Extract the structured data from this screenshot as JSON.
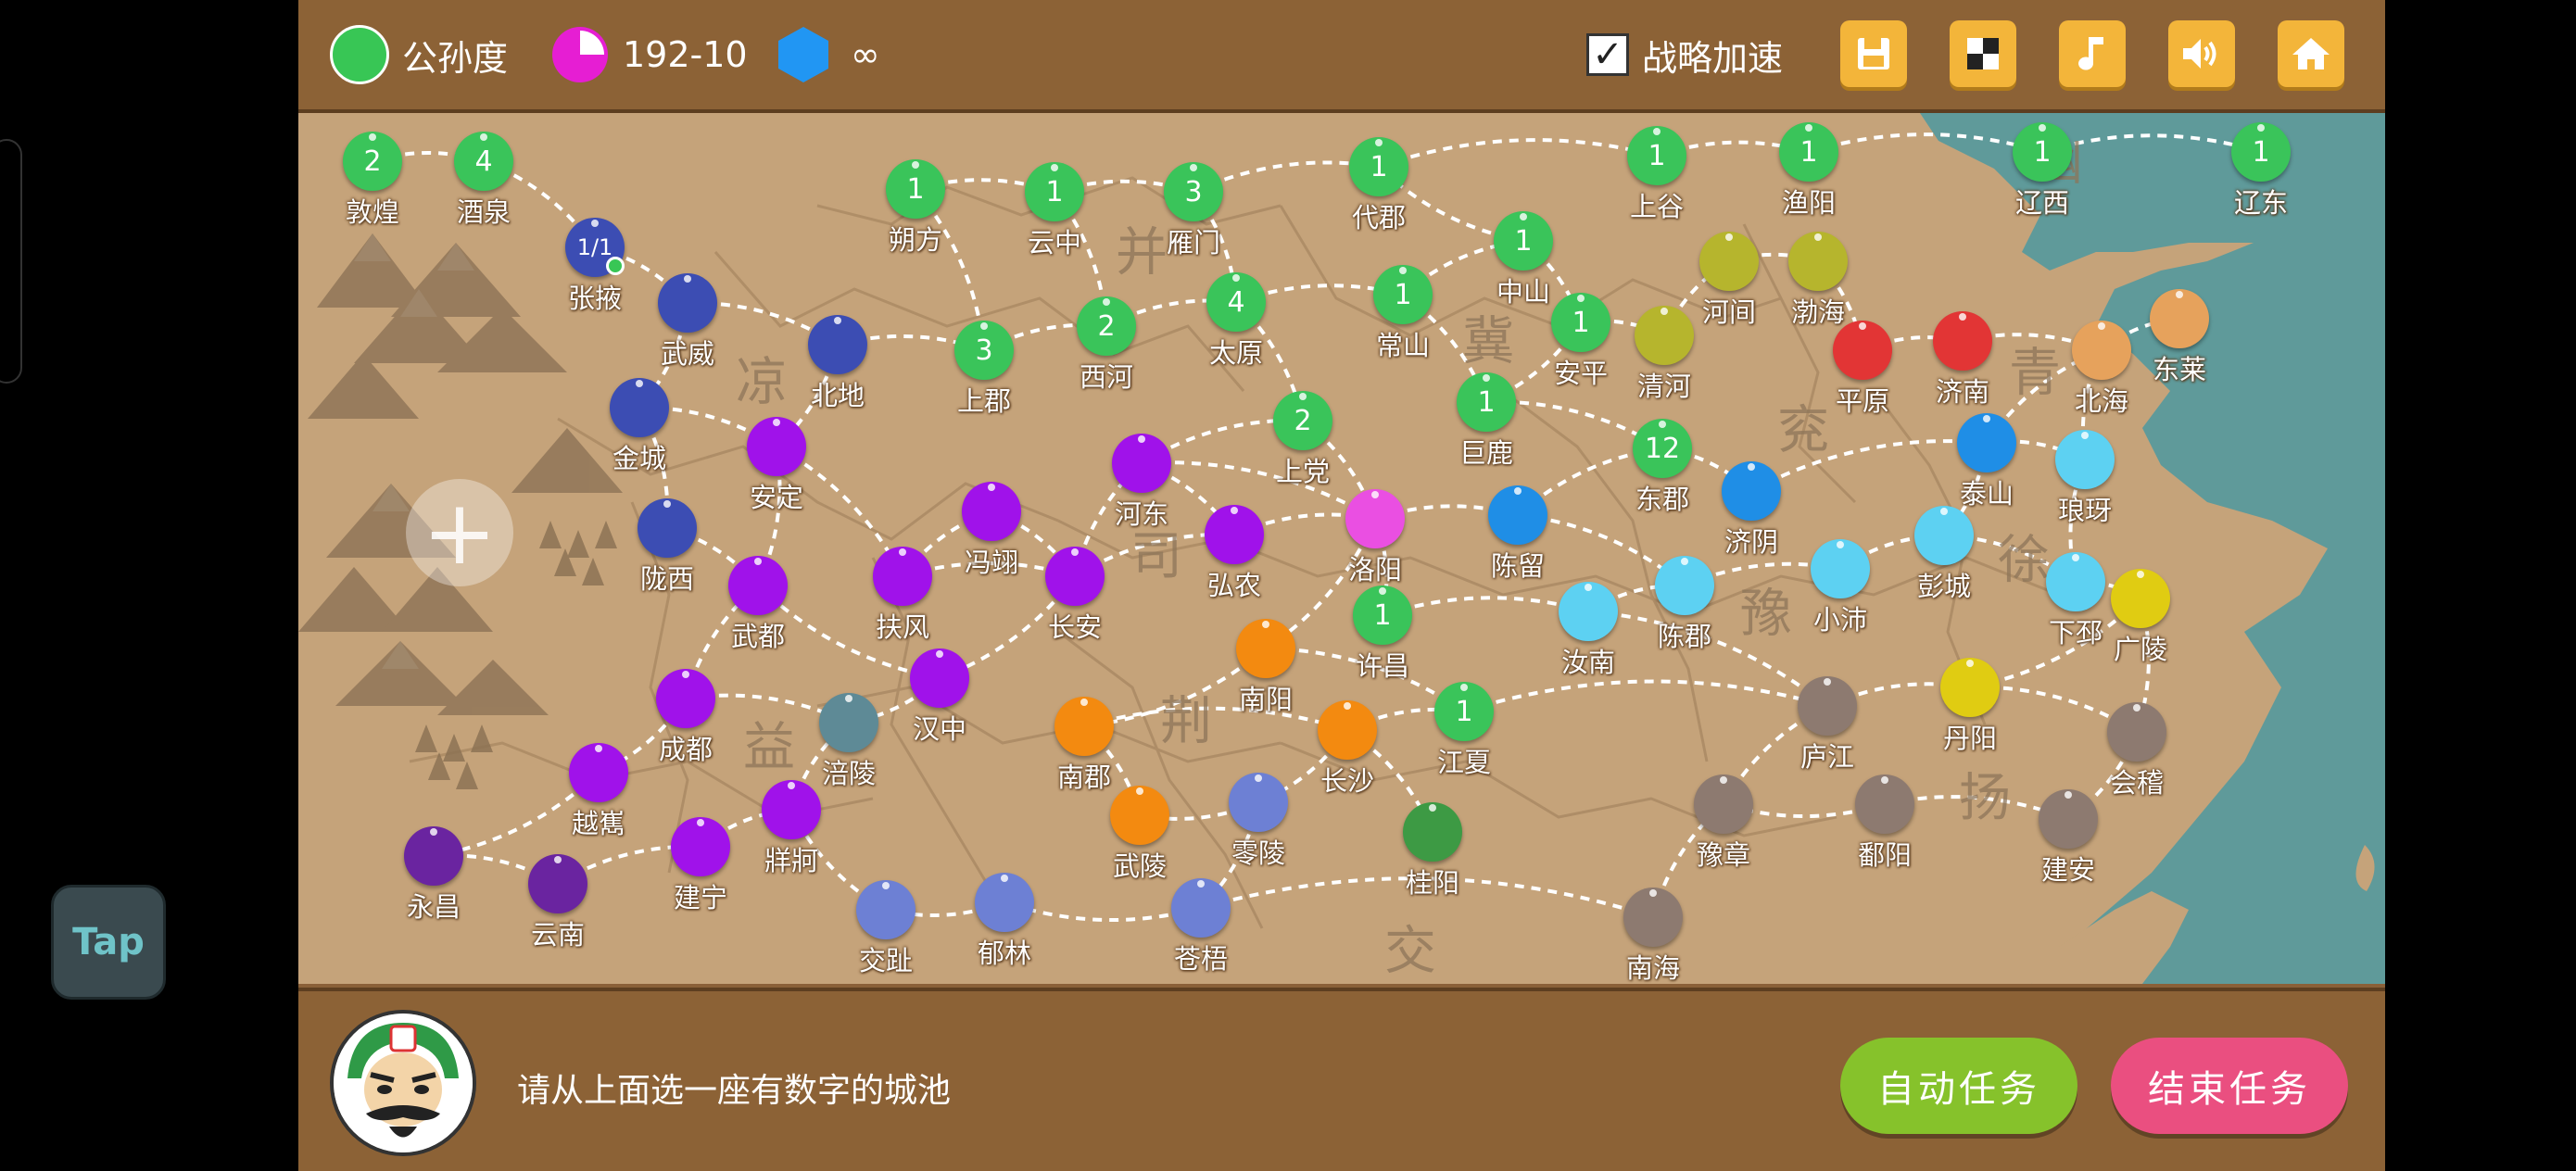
{
  "tap_label": "Tap",
  "topbar": {
    "ruler_name": "公孙度",
    "ruler_color": "#38c655",
    "date": "192-10",
    "date_icon_color": "#e61ed3",
    "resource": "∞",
    "resource_icon_color": "#2196f3",
    "speedup_label": "战略加速",
    "speedup_checked": "✓",
    "buttons": [
      "save-icon",
      "layout-icon",
      "music-icon",
      "sound-icon",
      "home-icon"
    ]
  },
  "map": {
    "zoom_label": "+",
    "regions": [
      "幽",
      "并",
      "冀",
      "凉",
      "司",
      "兖",
      "青",
      "徐",
      "豫",
      "荆",
      "益",
      "扬",
      "交"
    ],
    "cities": [
      {
        "name": "敦煌",
        "color": "#3ac45a",
        "num": "2"
      },
      {
        "name": "酒泉",
        "color": "#3ac45a",
        "num": "4"
      },
      {
        "name": "张掖",
        "color": "#3c4db3",
        "num": "1/1"
      },
      {
        "name": "武威",
        "color": "#3c4db3",
        "num": ""
      },
      {
        "name": "北地",
        "color": "#3c4db3",
        "num": ""
      },
      {
        "name": "金城",
        "color": "#3c4db3",
        "num": ""
      },
      {
        "name": "陇西",
        "color": "#3c4db3",
        "num": ""
      },
      {
        "name": "安定",
        "color": "#a012ea",
        "num": ""
      },
      {
        "name": "武都",
        "color": "#a012ea",
        "num": ""
      },
      {
        "name": "扶风",
        "color": "#a012ea",
        "num": ""
      },
      {
        "name": "冯翊",
        "color": "#a012ea",
        "num": ""
      },
      {
        "name": "河东",
        "color": "#a012ea",
        "num": ""
      },
      {
        "name": "长安",
        "color": "#a012ea",
        "num": ""
      },
      {
        "name": "弘农",
        "color": "#a012ea",
        "num": ""
      },
      {
        "name": "汉中",
        "color": "#a012ea",
        "num": ""
      },
      {
        "name": "成都",
        "color": "#a012ea",
        "num": ""
      },
      {
        "name": "越嶲",
        "color": "#a012ea",
        "num": ""
      },
      {
        "name": "牂牁",
        "color": "#a012ea",
        "num": ""
      },
      {
        "name": "建宁",
        "color": "#a012ea",
        "num": ""
      },
      {
        "name": "永昌",
        "color": "#6a24a0",
        "num": ""
      },
      {
        "name": "云南",
        "color": "#6a24a0",
        "num": ""
      },
      {
        "name": "涪陵",
        "color": "#5e8a96",
        "num": ""
      },
      {
        "name": "朔方",
        "color": "#3ac45a",
        "num": "1"
      },
      {
        "name": "云中",
        "color": "#3ac45a",
        "num": "1"
      },
      {
        "name": "雁门",
        "color": "#3ac45a",
        "num": "3"
      },
      {
        "name": "代郡",
        "color": "#3ac45a",
        "num": "1"
      },
      {
        "name": "上谷",
        "color": "#3ac45a",
        "num": "1"
      },
      {
        "name": "渔阳",
        "color": "#3ac45a",
        "num": "1"
      },
      {
        "name": "辽西",
        "color": "#3ac45a",
        "num": "1"
      },
      {
        "name": "辽东",
        "color": "#3ac45a",
        "num": "1"
      },
      {
        "name": "上郡",
        "color": "#3ac45a",
        "num": "3"
      },
      {
        "name": "西河",
        "color": "#3ac45a",
        "num": "2"
      },
      {
        "name": "太原",
        "color": "#3ac45a",
        "num": "4"
      },
      {
        "name": "上党",
        "color": "#3ac45a",
        "num": "2"
      },
      {
        "name": "常山",
        "color": "#3ac45a",
        "num": "1"
      },
      {
        "name": "中山",
        "color": "#3ac45a",
        "num": "1"
      },
      {
        "name": "安平",
        "color": "#3ac45a",
        "num": "1"
      },
      {
        "name": "巨鹿",
        "color": "#3ac45a",
        "num": "1"
      },
      {
        "name": "东郡",
        "color": "#3ac45a",
        "num": "12"
      },
      {
        "name": "许昌",
        "color": "#3ac45a",
        "num": "1"
      },
      {
        "name": "江夏",
        "color": "#3ac45a",
        "num": "1"
      },
      {
        "name": "河间",
        "color": "#b6b52d",
        "num": ""
      },
      {
        "name": "渤海",
        "color": "#b6b52d",
        "num": ""
      },
      {
        "name": "清河",
        "color": "#b6b52d",
        "num": ""
      },
      {
        "name": "平原",
        "color": "#e23535",
        "num": ""
      },
      {
        "name": "济南",
        "color": "#e23535",
        "num": ""
      },
      {
        "name": "北海",
        "color": "#e6a25c",
        "num": ""
      },
      {
        "name": "东莱",
        "color": "#e6a25c",
        "num": ""
      },
      {
        "name": "洛阳",
        "color": "#ea4fe2",
        "num": ""
      },
      {
        "name": "陈留",
        "color": "#1f8ee6",
        "num": ""
      },
      {
        "name": "济阴",
        "color": "#1f8ee6",
        "num": ""
      },
      {
        "name": "泰山",
        "color": "#1f8ee6",
        "num": ""
      },
      {
        "name": "琅玡",
        "color": "#5dd1f2",
        "num": ""
      },
      {
        "name": "彭城",
        "color": "#5dd1f2",
        "num": ""
      },
      {
        "name": "下邳",
        "color": "#5dd1f2",
        "num": ""
      },
      {
        "name": "陈郡",
        "color": "#5dd1f2",
        "num": ""
      },
      {
        "name": "小沛",
        "color": "#5dd1f2",
        "num": ""
      },
      {
        "name": "汝南",
        "color": "#5dd1f2",
        "num": ""
      },
      {
        "name": "广陵",
        "color": "#e0cc12",
        "num": ""
      },
      {
        "name": "丹阳",
        "color": "#e0cc12",
        "num": ""
      },
      {
        "name": "南阳",
        "color": "#f38a10",
        "num": ""
      },
      {
        "name": "南郡",
        "color": "#f38a10",
        "num": ""
      },
      {
        "name": "长沙",
        "color": "#f38a10",
        "num": ""
      },
      {
        "name": "武陵",
        "color": "#f38a10",
        "num": ""
      },
      {
        "name": "零陵",
        "color": "#6d80d4",
        "num": ""
      },
      {
        "name": "交趾",
        "color": "#6d80d4",
        "num": ""
      },
      {
        "name": "郁林",
        "color": "#6d80d4",
        "num": ""
      },
      {
        "name": "苍梧",
        "color": "#6d80d4",
        "num": ""
      },
      {
        "name": "桂阳",
        "color": "#3d9a44",
        "num": ""
      },
      {
        "name": "庐江",
        "color": "#8d7a70",
        "num": ""
      },
      {
        "name": "豫章",
        "color": "#8d7a70",
        "num": ""
      },
      {
        "name": "鄱阳",
        "color": "#8d7a70",
        "num": ""
      },
      {
        "name": "会稽",
        "color": "#8d7a70",
        "num": ""
      },
      {
        "name": "建安",
        "color": "#8d7a70",
        "num": ""
      },
      {
        "name": "南海",
        "color": "#8d7a70",
        "num": ""
      }
    ]
  },
  "bottombar": {
    "prompt": "请从上面选一座有数字的城池",
    "auto_task": "自动任务",
    "end_task": "结束任务",
    "auto_color": "#86c22b",
    "end_color": "#ea4f80"
  }
}
